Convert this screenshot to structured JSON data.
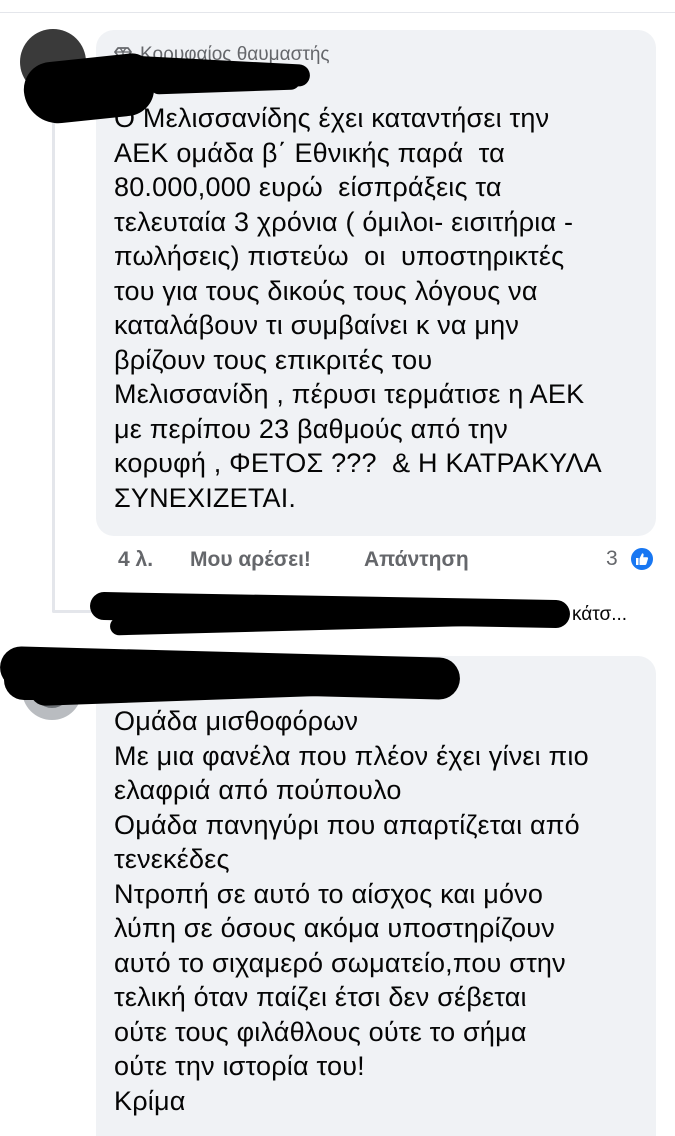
{
  "colors": {
    "bubble_bg": "#f0f2f5",
    "meta_text": "#65676b",
    "text": "#050505",
    "reaction_blue": "#1877f2"
  },
  "comment_1": {
    "badge_icon": "diamond-icon",
    "badge": "Κορυφαίος θαυμαστής",
    "text": "Ο Μελισσανίδης έχει καταντήσει την\nΑΕΚ ομάδα β΄ Εθνικής παρά  τα\n80.000,000 ευρώ  είσπράξεις τα\nτελευταία 3 χρόνια ( όμιλοι- εισιτήρια -\nπωλήσεις) πιστεύω  οι  υποστηρικτές\nτου για τους δικούς τους λόγους να\nκαταλάβουν τι συμβαίνει κ να μην\nβρίζουν τους επικριτές του\nΜελισσανίδη , πέρυσι τερμάτισε η ΑΕΚ\nμε περίπου 23 βαθμούς από την\nκορυφή , ΦΕΤΟΣ ???  & Η ΚΑΤΡΑΚΥΛΑ\nΣΥΝΕΧΙΖΕΤΑΙ.",
    "time": "4 λ.",
    "like_label": "Μου αρέσει!",
    "reply_label": "Απάντηση",
    "reaction_count": "3",
    "reaction_icon": "like-thumb-icon"
  },
  "reply_preview": {
    "text": "κάτσ..."
  },
  "comment_2": {
    "text": "Ομάδα μισθοφόρων\nΜε μια φανέλα που πλέον έχει γίνει πιο\nελαφριά από πούπουλο\nΟμάδα πανηγύρι που απαρτίζεται από\nτενεκέδες\nΝτροπή σε αυτό το αίσχος και μόνο\nλύπη σε όσους ακόμα υποστηρίζουν\nαυτό το σιχαμερό σωματείο,που στην\nτελική όταν παίζει έτσι δεν σέβεται\nούτε τους φιλάθλους ούτε το σήμα\nούτε την ιστορία του!\nΚρίμα"
  }
}
